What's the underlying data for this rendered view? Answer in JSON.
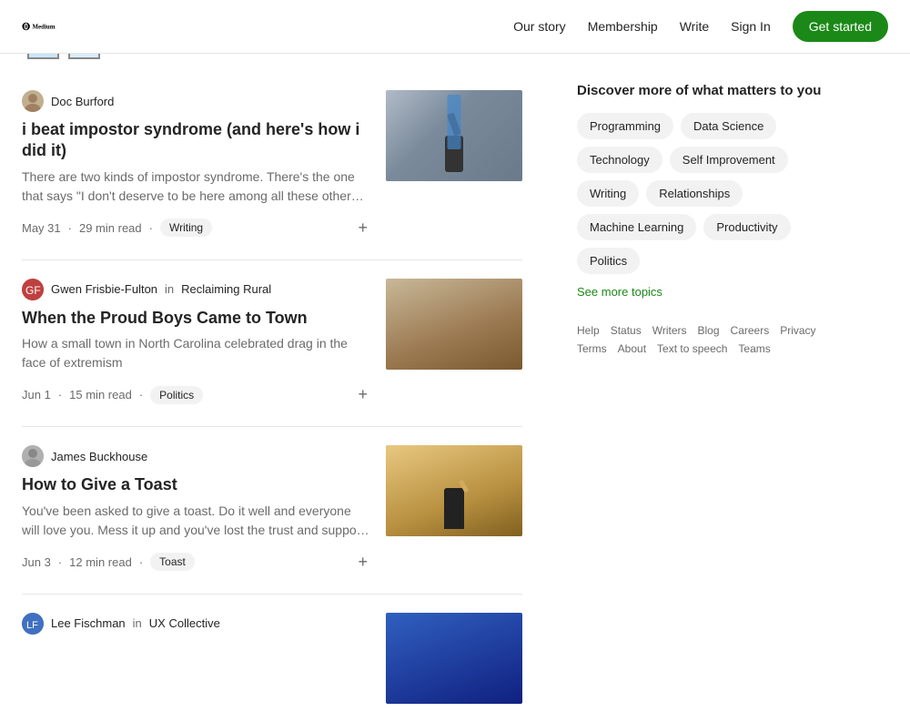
{
  "header": {
    "logo_text": "Medium",
    "nav": {
      "our_story": "Our story",
      "membership": "Membership",
      "write": "Write",
      "sign_in": "Sign In",
      "get_started": "Get started"
    }
  },
  "sidebar": {
    "discover_title": "Discover more of what matters to you",
    "topics": [
      "Programming",
      "Data Science",
      "Technology",
      "Self Improvement",
      "Writing",
      "Relationships",
      "Machine Learning",
      "Productivity",
      "Politics"
    ],
    "see_more": "See more topics",
    "footer_links": [
      "Help",
      "Status",
      "Writers",
      "Blog",
      "Careers",
      "Privacy",
      "Terms",
      "About",
      "Text to speech",
      "Teams"
    ]
  },
  "articles": [
    {
      "id": "1",
      "author": "Doc Burford",
      "publication": null,
      "title": "i beat impostor syndrome (and here's how i did it)",
      "excerpt": "There are two kinds of impostor syndrome. There's the one that says \"I don't deserve to be here among all these other people…",
      "date": "May 31",
      "read_time": "29 min read",
      "tag": "Writing",
      "image_color": "#8090a0"
    },
    {
      "id": "2",
      "author": "Gwen Frisbie-Fulton",
      "publication": "Reclaiming Rural",
      "title": "When the Proud Boys Came to Town",
      "excerpt": "How a small town in North Carolina celebrated drag in the face of extremism",
      "date": "Jun 1",
      "read_time": "15 min read",
      "tag": "Politics",
      "image_color": "#c4a882"
    },
    {
      "id": "3",
      "author": "James Buckhouse",
      "publication": null,
      "title": "How to Give a Toast",
      "excerpt": "You've been asked to give a toast. Do it well and everyone will love you. Mess it up and you've lost the trust and support of…",
      "date": "Jun 3",
      "read_time": "12 min read",
      "tag": "Toast",
      "image_color": "#d4a850"
    },
    {
      "id": "4",
      "author": "Lee Fischman",
      "publication": "UX Collective",
      "title": "",
      "excerpt": "",
      "date": "",
      "read_time": "",
      "tag": "",
      "image_color": "#2040a0"
    }
  ]
}
